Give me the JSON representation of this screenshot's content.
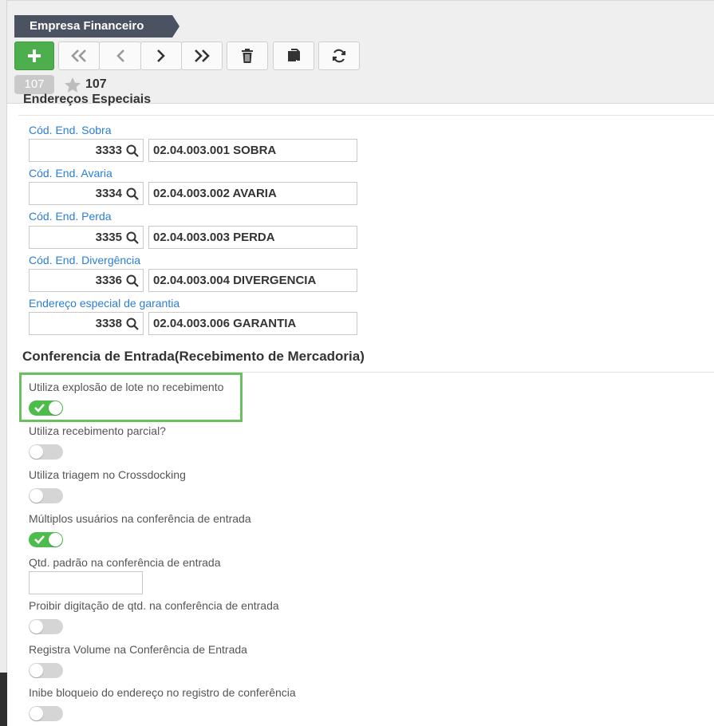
{
  "header": {
    "title": "Empresa Financeiro",
    "record_badge": "107",
    "favorite_count": "107"
  },
  "toolbar": {
    "buttons": [
      "add-icon",
      "first-icon",
      "previous-icon",
      "next-icon",
      "last-icon",
      "trash-icon",
      "copy-icon",
      "refresh-icon"
    ]
  },
  "addresses": [
    {
      "label": "Cód. End. Sobra",
      "code": "3333",
      "description": "02.04.003.001 SOBRA"
    },
    {
      "label": "Cód. End. Avaria",
      "code": "3334",
      "description": "02.04.003.002 AVARIA"
    },
    {
      "label": "Cód. End. Perda",
      "code": "3335",
      "description": "02.04.003.003 PERDA"
    },
    {
      "label": "Cód. End. Divergência",
      "code": "3336",
      "description": "02.04.003.004 DIVERGENCIA"
    },
    {
      "label": "Endereço especial de garantia",
      "code": "3338",
      "description": "02.04.003.006 GARANTIA"
    }
  ],
  "conferencia": {
    "title": "Conferencia de Entrada(Recebimento de Mercadoria)",
    "options": [
      {
        "label": "Utiliza explosão de lote no recebimento",
        "on": true
      },
      {
        "label": "Utiliza recebimento parcial?",
        "on": false
      },
      {
        "label": "Utiliza triagem no Crossdocking",
        "on": false
      },
      {
        "label": "Múltiplos usuários na conferência de entrada",
        "on": true
      },
      {
        "label": "Qtd. padrão na conferência de entrada",
        "value": ""
      },
      {
        "label": "Proibir digitação de qtd. na conferência de entrada",
        "on": false
      },
      {
        "label": "Registra Volume na Conferência de Entrada",
        "on": false
      },
      {
        "label": "Inibe bloqueio do endereço no registro de conferência",
        "on": false
      }
    ]
  },
  "colors": {
    "accent_link": "#2a7fd4",
    "toggle_on": "#4cbc4c",
    "highlight": "#6abf5e",
    "title_tab": "#4b5262"
  }
}
